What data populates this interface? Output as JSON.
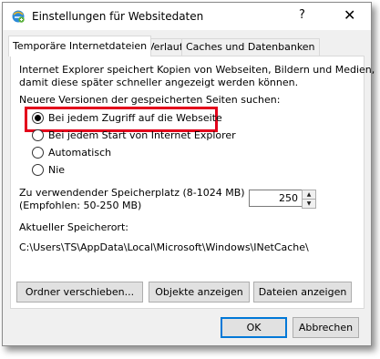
{
  "window": {
    "title": "Einstellungen für Websitedaten",
    "help": "?",
    "close": "✕"
  },
  "tabs": [
    {
      "label": "Temporäre Internetdateien",
      "active": true
    },
    {
      "label": "Verlauf",
      "active": false
    },
    {
      "label": "Caches und Datenbanken",
      "active": false
    }
  ],
  "panel": {
    "description": [
      "Internet Explorer speichert Kopien von Webseiten, Bildern und Medien,",
      "damit diese später schneller angezeigt werden können."
    ],
    "check_heading": "Neuere Versionen der gespeicherten Seiten suchen:",
    "options": [
      {
        "label": "Bei jedem Zugriff auf die Webseite",
        "checked": true
      },
      {
        "label": "Bei jedem Start von Internet Explorer",
        "checked": false
      },
      {
        "label": "Automatisch",
        "checked": false
      },
      {
        "label": "Nie",
        "checked": false
      }
    ],
    "disk_label_line1": "Zu verwendender Speicherplatz (8-1024 MB)",
    "disk_label_line2": "(Empfohlen: 50-250 MB)",
    "disk_value": "250",
    "location_label": "Aktueller Speicherort:",
    "location_path": "C:\\Users\\TS\\AppData\\Local\\Microsoft\\Windows\\INetCache\\",
    "buttons": {
      "move_folder": "Ordner verschieben...",
      "view_objects": "Objekte anzeigen",
      "view_files": "Dateien anzeigen"
    }
  },
  "footer": {
    "ok": "OK",
    "cancel": "Abbrechen"
  },
  "colors": {
    "highlight": "#e3001b",
    "accent": "#0078d7"
  }
}
